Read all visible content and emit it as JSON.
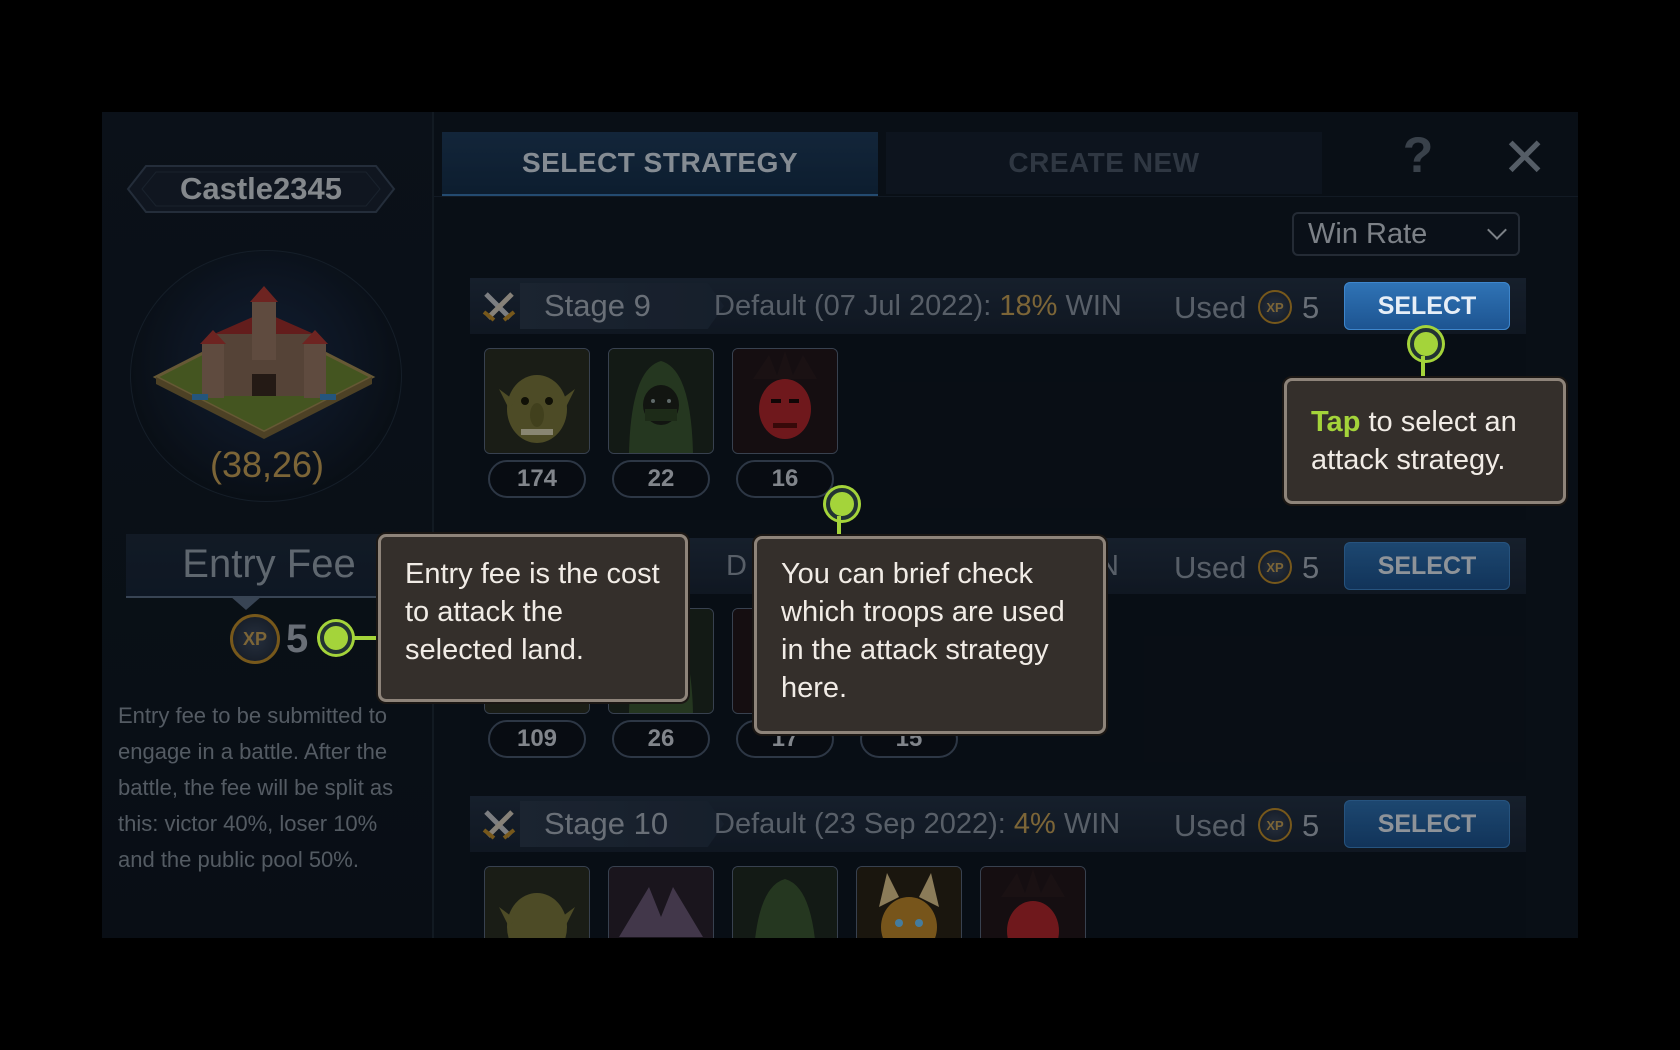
{
  "castle": {
    "name": "Castle2345",
    "coords": "(38,26)"
  },
  "entry_fee": {
    "title": "Entry Fee",
    "amount": "5",
    "currency_icon": "XP",
    "description": "Entry fee to be submitted to engage in a battle. After the battle, the fee will be split as this: victor 40%, loser 10% and the public pool 50%."
  },
  "tabs": {
    "select_strategy": "SELECT STRATEGY",
    "create_new": "CREATE NEW"
  },
  "header_buttons": {
    "help": "?",
    "close": "✕"
  },
  "sort": {
    "selected": "Win Rate"
  },
  "strategies": [
    {
      "stage": "Stage 9",
      "default_label": "Default (07 Jul 2022):",
      "win_pct": "18%",
      "win_label": "WIN",
      "used_label": "Used",
      "cost": "5",
      "select_label": "SELECT",
      "troops": [
        {
          "name": "goblin",
          "count": "174"
        },
        {
          "name": "hooded-assassin",
          "count": "22"
        },
        {
          "name": "red-demon",
          "count": "16"
        }
      ]
    },
    {
      "stage": "",
      "default_label": "D",
      "win_pct": "",
      "win_label": "IN",
      "used_label": "Used",
      "cost": "5",
      "select_label": "SELECT",
      "troops": [
        {
          "name": "goblin",
          "count": "109"
        },
        {
          "name": "hooded-assassin",
          "count": "26"
        },
        {
          "name": "red-demon",
          "count": "17"
        },
        {
          "name": "unknown",
          "count": "15"
        }
      ]
    },
    {
      "stage": "Stage 10",
      "default_label": "Default (23 Sep 2022):",
      "win_pct": "4%",
      "win_label": "WIN",
      "used_label": "Used",
      "cost": "5",
      "select_label": "SELECT",
      "troops": [
        {
          "name": "goblin"
        },
        {
          "name": "bat-beast"
        },
        {
          "name": "hooded-assassin"
        },
        {
          "name": "horned-warrior"
        },
        {
          "name": "red-demon"
        }
      ]
    }
  ],
  "tooltips": {
    "select_tip_highlight": "Tap",
    "select_tip_rest": " to select an attack strategy.",
    "entry_fee_tip": "Entry fee is the cost to attack the selected land.",
    "troops_tip": "You can brief check which troops are used in the attack strategy here."
  },
  "colors": {
    "highlight": "#a4d43a",
    "win_gold": "#c9a45a",
    "select_blue": "#2f73b5"
  }
}
